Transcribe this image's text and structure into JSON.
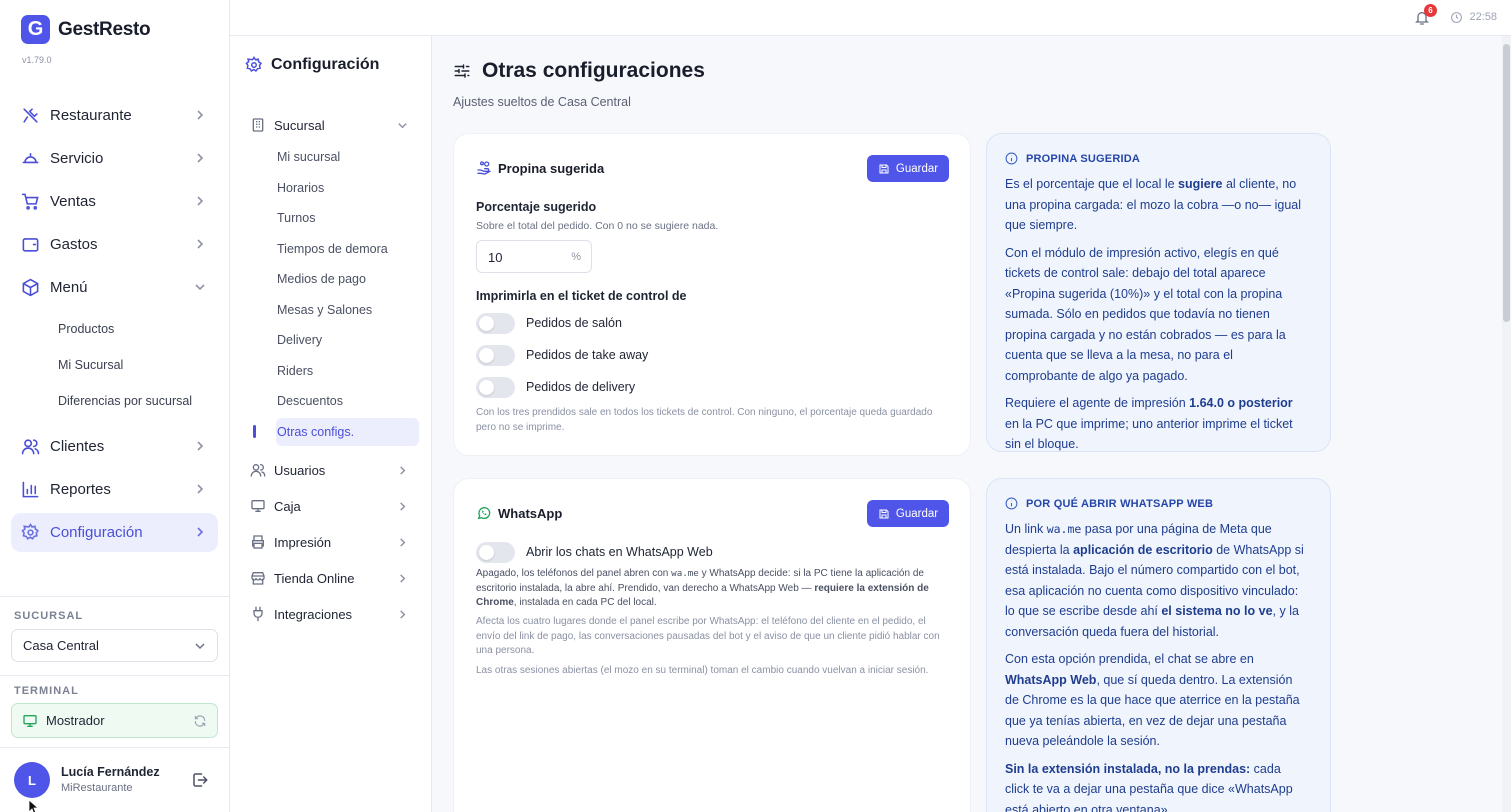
{
  "app": {
    "logo_letter": "G",
    "name": "GestResto",
    "version": "v1.79.0"
  },
  "sidebar": {
    "items": [
      {
        "label": "Restaurante"
      },
      {
        "label": "Servicio"
      },
      {
        "label": "Ventas"
      },
      {
        "label": "Gastos"
      },
      {
        "label": "Menú"
      },
      {
        "label": "Clientes"
      },
      {
        "label": "Reportes"
      },
      {
        "label": "Configuración"
      }
    ],
    "menu_subitems": [
      "Productos",
      "Mi Sucursal",
      "Diferencias por sucursal"
    ],
    "branch_label": "SUCURSAL",
    "branch_value": "Casa Central",
    "terminal_label": "TERMINAL",
    "terminal_value": "Mostrador",
    "user": {
      "initial": "L",
      "name": "Lucía Fernández",
      "org": "MiRestaurante"
    }
  },
  "topbar": {
    "notifications": "6",
    "time": "22:58"
  },
  "config_nav": {
    "title": "Configuración",
    "groups": [
      {
        "label": "Sucursal"
      },
      {
        "label": "Usuarios"
      },
      {
        "label": "Caja"
      },
      {
        "label": "Impresión"
      },
      {
        "label": "Tienda Online"
      },
      {
        "label": "Integraciones"
      }
    ],
    "sucursal_items": [
      "Mi sucursal",
      "Horarios",
      "Turnos",
      "Tiempos de demora",
      "Medios de pago",
      "Mesas y Salones",
      "Delivery",
      "Riders",
      "Descuentos",
      "Otras configs."
    ]
  },
  "page": {
    "title": "Otras configuraciones",
    "subtitle": "Ajustes sueltos de Casa Central"
  },
  "tip_card": {
    "title": "Propina sugerida",
    "save_label": "Guardar",
    "pct_label": "Porcentaje sugerido",
    "pct_help": "Sobre el total del pedido. Con 0 no se sugiere nada.",
    "pct_value": "10",
    "pct_unit": "%",
    "print_label": "Imprimirla en el ticket de control de",
    "toggles": [
      {
        "label": "Pedidos de salón",
        "on": false
      },
      {
        "label": "Pedidos de take away",
        "on": false
      },
      {
        "label": "Pedidos de delivery",
        "on": false
      }
    ],
    "note": "Con los tres prendidos sale en todos los tickets de control. Con ninguno, el porcentaje queda guardado pero no se imprime."
  },
  "whatsapp_card": {
    "title": "WhatsApp",
    "save_label": "Guardar",
    "toggle_label": "Abrir los chats en WhatsApp Web",
    "toggle_on": false,
    "desc_a": "Apagado, los teléfonos del panel abren con ",
    "desc_code": "wa.me",
    "desc_b": " y WhatsApp decide: si la PC tiene la aplicación de escritorio instalada, la abre ahí. Prendido, van derecho a WhatsApp Web — ",
    "desc_bold": "requiere la extensión de Chrome",
    "desc_c": ", instalada en cada PC del local.",
    "note1": "Afecta los cuatro lugares donde el panel escribe por WhatsApp: el teléfono del cliente en el pedido, el envío del link de pago, las conversaciones pausadas del bot y el aviso de que un cliente pidió hablar con una persona.",
    "note2": "Las otras sesiones abiertas (el mozo en su terminal) toman el cambio cuando vuelvan a iniciar sesión."
  },
  "tip_info": {
    "heading": "PROPINA SUGERIDA",
    "p1_a": "Es el porcentaje que el local le ",
    "p1_b": "sugiere",
    "p1_c": " al cliente, no una propina cargada: el mozo la cobra —o no— igual que siempre.",
    "p2": "Con el módulo de impresión activo, elegís en qué tickets de control sale: debajo del total aparece «Propina sugerida (10%)» y el total con la propina sumada. Sólo en pedidos que todavía no tienen propina cargada y no están cobrados — es para la cuenta que se lleva a la mesa, no para el comprobante de algo ya pagado.",
    "p3_a": "Requiere el agente de impresión ",
    "p3_b": "1.64.0 o posterior",
    "p3_c": " en la PC que imprime; uno anterior imprime el ticket sin el bloque."
  },
  "wa_info": {
    "heading": "POR QUÉ ABRIR WHATSAPP WEB",
    "p1_a": "Un link ",
    "p1_code": "wa.me",
    "p1_b": " pasa por una página de Meta que despierta la ",
    "p1_bold1": "aplicación de escritorio",
    "p1_c": " de WhatsApp si está instalada. Bajo el número compartido con el bot, esa aplicación no cuenta como dispositivo vinculado: lo que se escribe desde ahí ",
    "p1_bold2": "el sistema no lo ve",
    "p1_d": ", y la conversación queda fuera del historial.",
    "p2_a": "Con esta opción prendida, el chat se abre en ",
    "p2_bold": "WhatsApp Web",
    "p2_b": ", que sí queda dentro. La extensión de Chrome es la que hace que aterrice en la pestaña que ya tenías abierta, en vez de dejar una pestaña nueva peleándole la sesión.",
    "p3_bold": "Sin la extensión instalada, no la prendas:",
    "p3_b": " cada click te va a dejar una pestaña que dice «WhatsApp está abierto en otra ventana»."
  },
  "colors": {
    "accent": "#4f55e8",
    "info_bg": "#f0f5fd",
    "info_text": "#1f3d8f",
    "terminal_green": "#22a35a",
    "badge_red": "#e5383b"
  }
}
